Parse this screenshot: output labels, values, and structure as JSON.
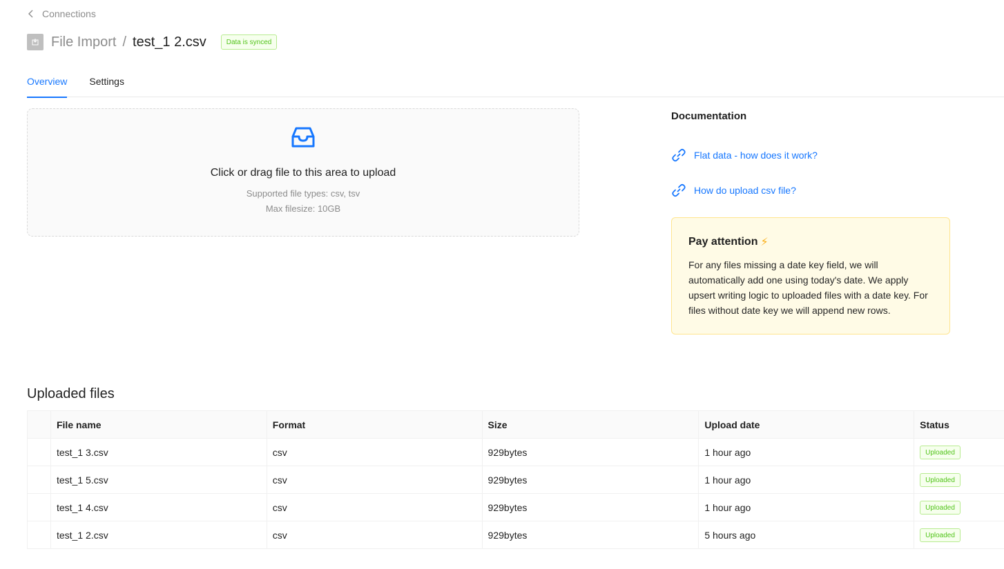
{
  "header": {
    "back_label": "Connections",
    "breadcrumb_parent": "File Import",
    "breadcrumb_separator": "/",
    "breadcrumb_current": "test_1 2.csv",
    "sync_badge": "Data is synced"
  },
  "tabs": [
    {
      "label": "Overview",
      "active": true
    },
    {
      "label": "Settings",
      "active": false
    }
  ],
  "upload": {
    "title": "Click or drag file to this area to upload",
    "types_hint": "Supported file types: csv, tsv",
    "size_hint": "Max filesize: 10GB",
    "icon": "inbox-icon"
  },
  "documentation": {
    "title": "Documentation",
    "links": [
      {
        "label": "Flat data - how does it work?",
        "icon": "link-icon"
      },
      {
        "label": "How do upload csv file?",
        "icon": "link-icon"
      }
    ]
  },
  "attention": {
    "title": "Pay attention",
    "emoji": "⚡",
    "text": "For any files missing a date key field, we will automatically add one using today's date. We apply upsert writing logic to uploaded files with a date key. For files without date key we will append new rows."
  },
  "files": {
    "title": "Uploaded files",
    "columns": [
      "File name",
      "Format",
      "Size",
      "Upload date",
      "Status"
    ],
    "rows": [
      {
        "name": "test_1 3.csv",
        "format": "csv",
        "size": "929bytes",
        "date": "1 hour ago",
        "status": "Uploaded"
      },
      {
        "name": "test_1 5.csv",
        "format": "csv",
        "size": "929bytes",
        "date": "1 hour ago",
        "status": "Uploaded"
      },
      {
        "name": "test_1 4.csv",
        "format": "csv",
        "size": "929bytes",
        "date": "1 hour ago",
        "status": "Uploaded"
      },
      {
        "name": "test_1 2.csv",
        "format": "csv",
        "size": "929bytes",
        "date": "5 hours ago",
        "status": "Uploaded"
      }
    ]
  },
  "colors": {
    "accent": "#1677ff",
    "success": "#52c41a",
    "warning_bg": "#fffbe6",
    "warning_border": "#ffe58f"
  }
}
